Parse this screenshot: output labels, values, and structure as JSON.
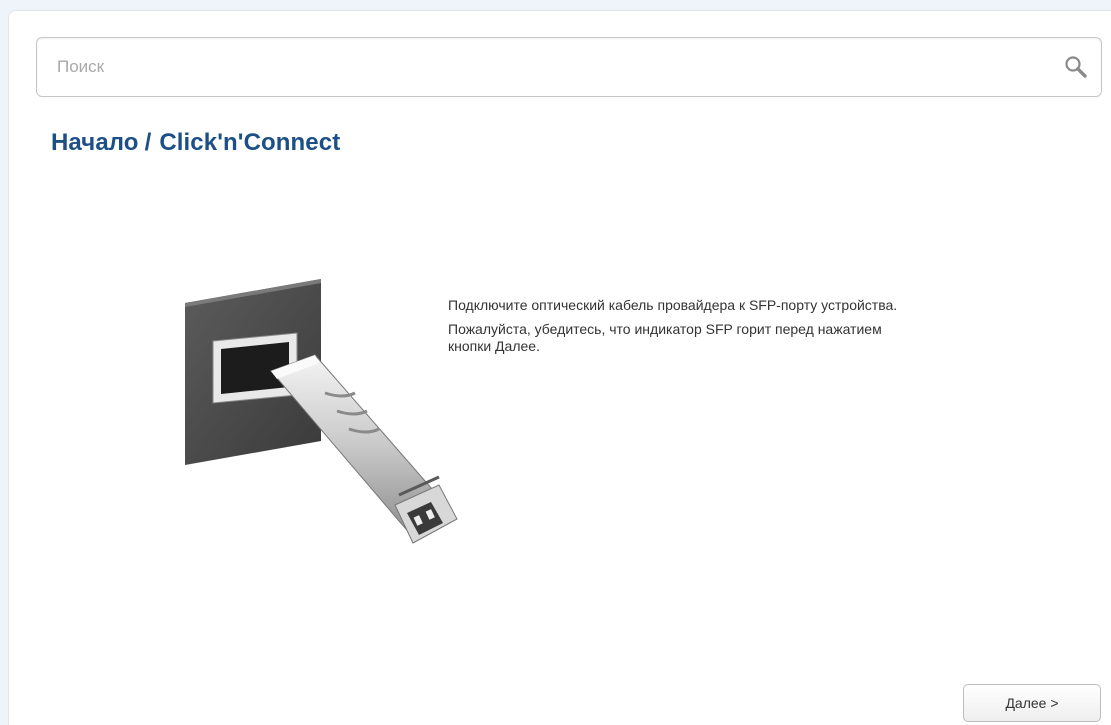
{
  "search": {
    "placeholder": "Поиск",
    "value": ""
  },
  "breadcrumb": {
    "root": "Начало",
    "separator": "/",
    "current": "Click'n'Connect"
  },
  "instructions": {
    "line1": "Подключите оптический кабель провайдера к SFP-порту устройства.",
    "line2": "Пожалуйста, убедитесь, что индикатор SFP горит перед нажатием кнопки Далее."
  },
  "actions": {
    "next_label": "Далее >"
  },
  "icons": {
    "search": "search-icon",
    "illustration": "sfp-cable-illustration"
  },
  "colors": {
    "title": "#1c4f86",
    "frame_background": "#eef4fa",
    "text": "#333333"
  }
}
